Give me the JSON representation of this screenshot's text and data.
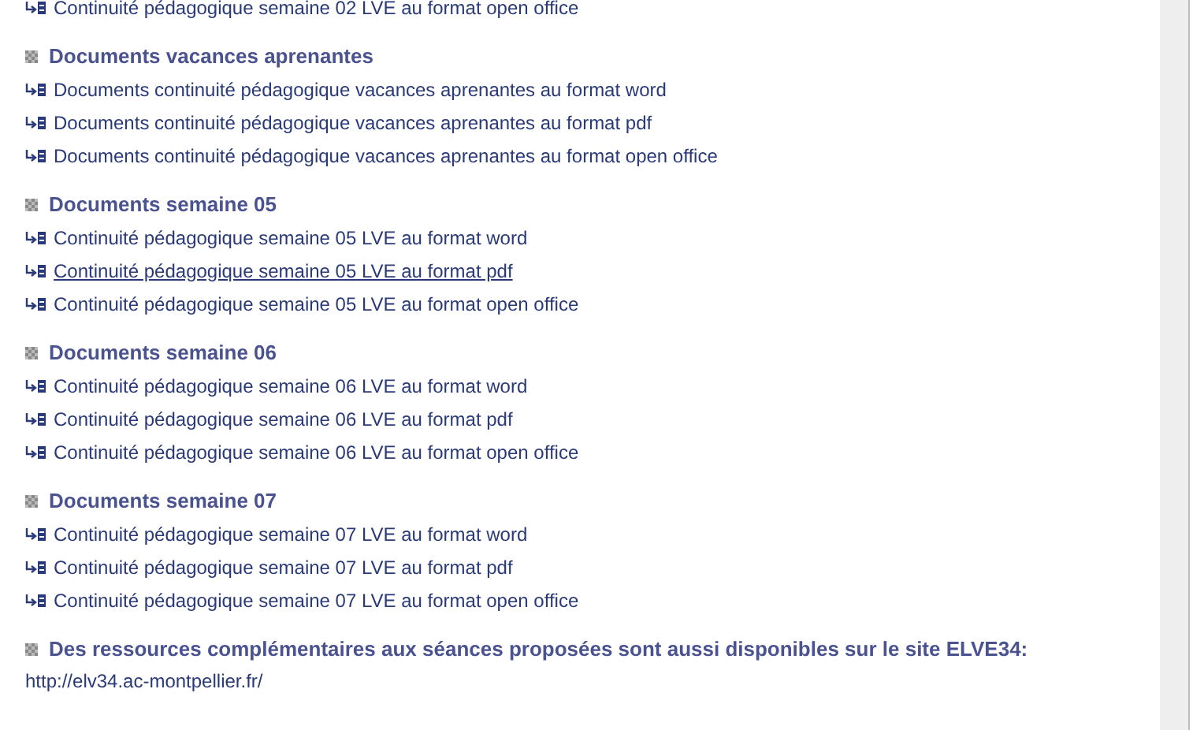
{
  "top_items": [
    {
      "label": "Continuité pédagogique semaine 02 LVE au format open office",
      "underlined": false
    }
  ],
  "sections": [
    {
      "heading": "Documents vacances aprenantes",
      "items": [
        {
          "label": "Documents continuité pédagogique vacances aprenantes au format word",
          "underlined": false
        },
        {
          "label": "Documents continuité pédagogique vacances aprenantes au format pdf",
          "underlined": false
        },
        {
          "label": "Documents continuité pédagogique vacances aprenantes au format open office",
          "underlined": false
        }
      ]
    },
    {
      "heading": "Documents semaine 05",
      "items": [
        {
          "label": "Continuité pédagogique semaine 05 LVE au format word",
          "underlined": false
        },
        {
          "label": "Continuité pédagogique semaine 05 LVE au format pdf",
          "underlined": true
        },
        {
          "label": "Continuité pédagogique semaine 05 LVE au format open office",
          "underlined": false
        }
      ]
    },
    {
      "heading": "Documents semaine 06",
      "items": [
        {
          "label": "Continuité pédagogique semaine 06 LVE au format word",
          "underlined": false
        },
        {
          "label": "Continuité pédagogique semaine 06 LVE au format pdf",
          "underlined": false
        },
        {
          "label": "Continuité pédagogique semaine 06 LVE au format open office",
          "underlined": false
        }
      ]
    },
    {
      "heading": "Documents semaine 07",
      "items": [
        {
          "label": "Continuité pédagogique semaine 07 LVE au format word",
          "underlined": false
        },
        {
          "label": "Continuité pédagogique semaine 07 LVE au format pdf",
          "underlined": false
        },
        {
          "label": "Continuité pédagogique semaine 07 LVE au format open office",
          "underlined": false
        }
      ]
    }
  ],
  "note": {
    "heading": "Des ressources complémentaires aux séances proposées sont aussi disponibles sur le site ELVE34:",
    "link": "http://elv34.ac-montpellier.fr/"
  }
}
